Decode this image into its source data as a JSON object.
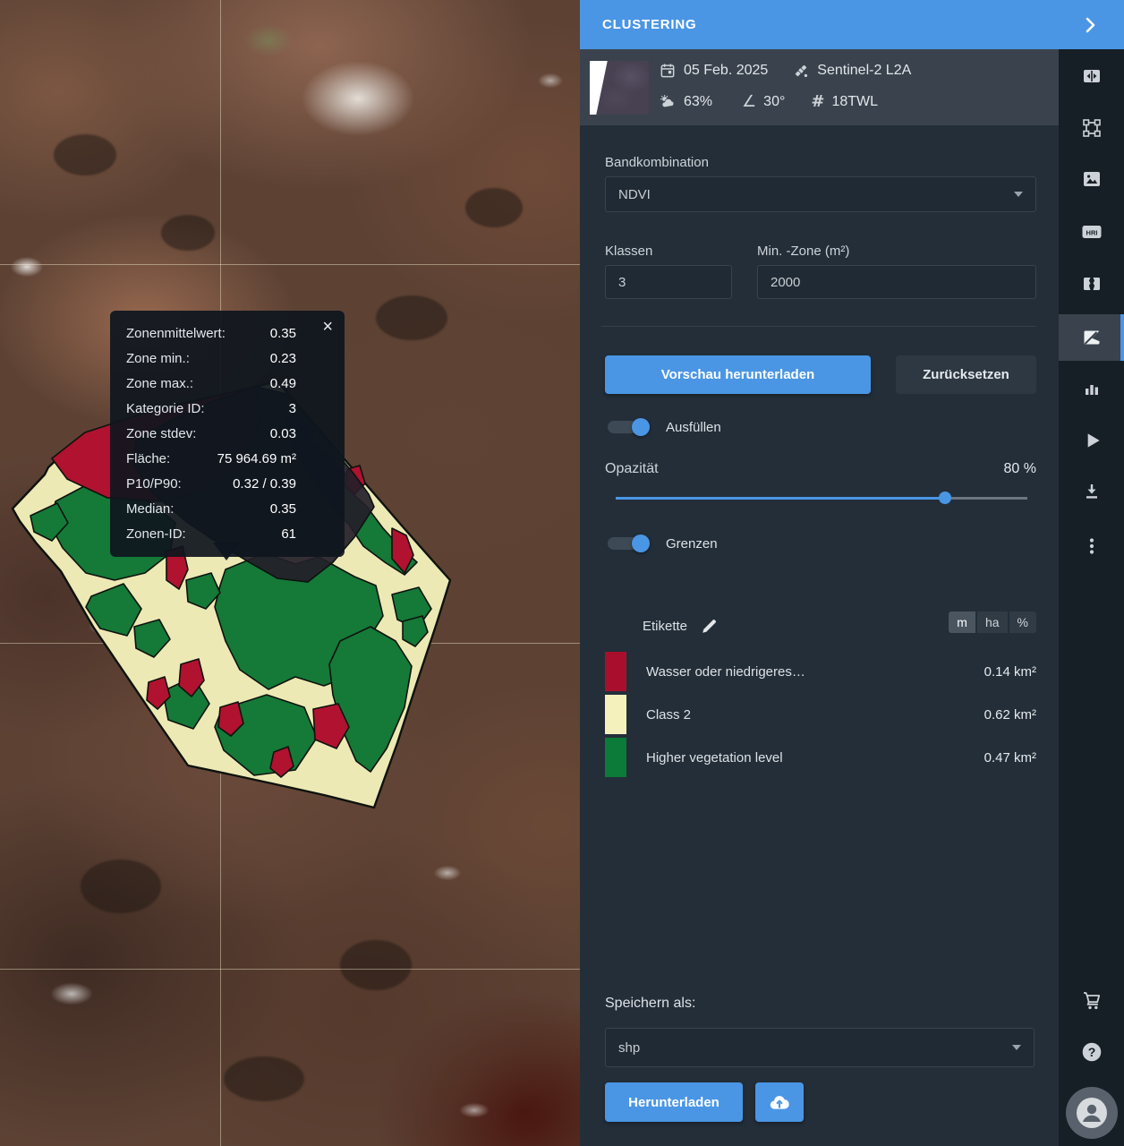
{
  "header": {
    "title": "CLUSTERING"
  },
  "scene": {
    "date": "05 Feb. 2025",
    "sensor": "Sentinel-2 L2A",
    "cloudiness": "63%",
    "angle": "30°",
    "tile": "18TWL"
  },
  "controls": {
    "band_label": "Bandkombination",
    "band_value": "NDVI",
    "classes_label": "Klassen",
    "classes_value": "3",
    "min_zone_label": "Min. -Zone (m²)",
    "min_zone_value": "2000",
    "preview_button": "Vorschau herunterladen",
    "reset_button": "Zurücksetzen",
    "fill_toggle": "Ausfüllen",
    "fill_on": true,
    "opacity_label": "Opazität",
    "opacity_value": "80 %",
    "opacity_percent": 80,
    "borders_toggle": "Grenzen",
    "borders_on": true
  },
  "legend": {
    "title": "Etikette",
    "units": [
      "m",
      "ha",
      "%"
    ],
    "selected_unit": "m",
    "classes": [
      {
        "label": "Wasser oder niedrigeres…",
        "area": "0.14 km²",
        "color": "#a90f2d"
      },
      {
        "label": "Class 2",
        "area": "0.62 km²",
        "color": "#f5f1bc"
      },
      {
        "label": "Higher vegetation level",
        "area": "0.47 km²",
        "color": "#0c7a38"
      }
    ]
  },
  "save": {
    "label": "Speichern als:",
    "format": "shp",
    "download_button": "Herunterladen"
  },
  "tooltip": {
    "rows": [
      {
        "label": "Zonenmittelwert:",
        "value": "0.35"
      },
      {
        "label": "Zone min.:",
        "value": "0.23"
      },
      {
        "label": "Zone max.:",
        "value": "0.49"
      },
      {
        "label": "Kategorie ID:",
        "value": "3"
      },
      {
        "label": "Zone stdev:",
        "value": "0.03"
      },
      {
        "label": "Fläche:",
        "value": "75 964.69 m²"
      },
      {
        "label": "P10/P90:",
        "value": "0.32 / 0.39"
      },
      {
        "label": "Median:",
        "value": "0.35"
      },
      {
        "label": "Zonen-ID:",
        "value": "61"
      }
    ],
    "close": "×"
  },
  "rail_icons": [
    "compare",
    "aoi",
    "image",
    "hri",
    "split-images",
    "clustering",
    "analytics",
    "play",
    "download",
    "more",
    "cart",
    "help",
    "account"
  ],
  "colors": {
    "accent_blue": "#4a96e4",
    "panel_bg": "#232e39",
    "rail_bg": "#161e26",
    "meta_bar_bg": "#3a434d",
    "zone_red": "#b01230",
    "zone_cream": "#ece9b4",
    "zone_green": "#157938",
    "selected_zone_dark": "#241e29"
  }
}
